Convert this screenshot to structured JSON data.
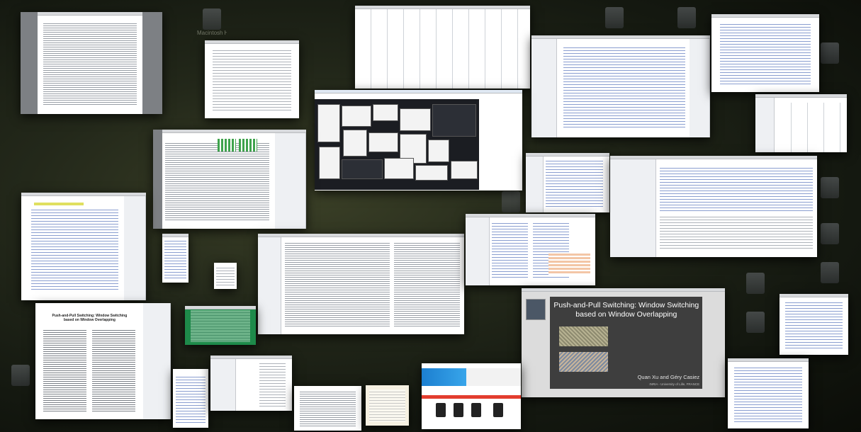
{
  "view": {
    "mode": "window-overview"
  },
  "desktop_icons": [
    {
      "label": "Macintosh HD",
      "icon": "hard-drive-icon"
    },
    {
      "label": "",
      "icon": "file-icon"
    },
    {
      "label": "",
      "icon": "file-icon"
    },
    {
      "label": "",
      "icon": "file-icon"
    },
    {
      "label": "",
      "icon": "file-icon"
    },
    {
      "label": "",
      "icon": "file-icon"
    },
    {
      "label": "",
      "icon": "file-icon"
    },
    {
      "label": "",
      "icon": "file-icon"
    },
    {
      "label": "",
      "icon": "file-icon"
    },
    {
      "label": "",
      "icon": "file-icon"
    },
    {
      "label": "",
      "icon": "file-icon"
    }
  ],
  "windows": {
    "presentation": {
      "slide_title": "Push-and-Pull Switching: Window Switching based on Window Overlapping",
      "authors": "Quan Xu and Géry Casiez",
      "affiliation": "INRIA - University of Lille, FRANCE"
    },
    "paper": {
      "title": "Push-and-Pull Switching: Window Switching based on Window Overlapping"
    }
  },
  "colors": {
    "desktop_bg": "#1c2116",
    "window_shadow": "#000000",
    "slide_bg": "#3e3e3e",
    "terminal_green": "#1e8a4a",
    "shop_banner_blue": "#2f8fd8",
    "shop_band_red": "#e33d2e"
  }
}
